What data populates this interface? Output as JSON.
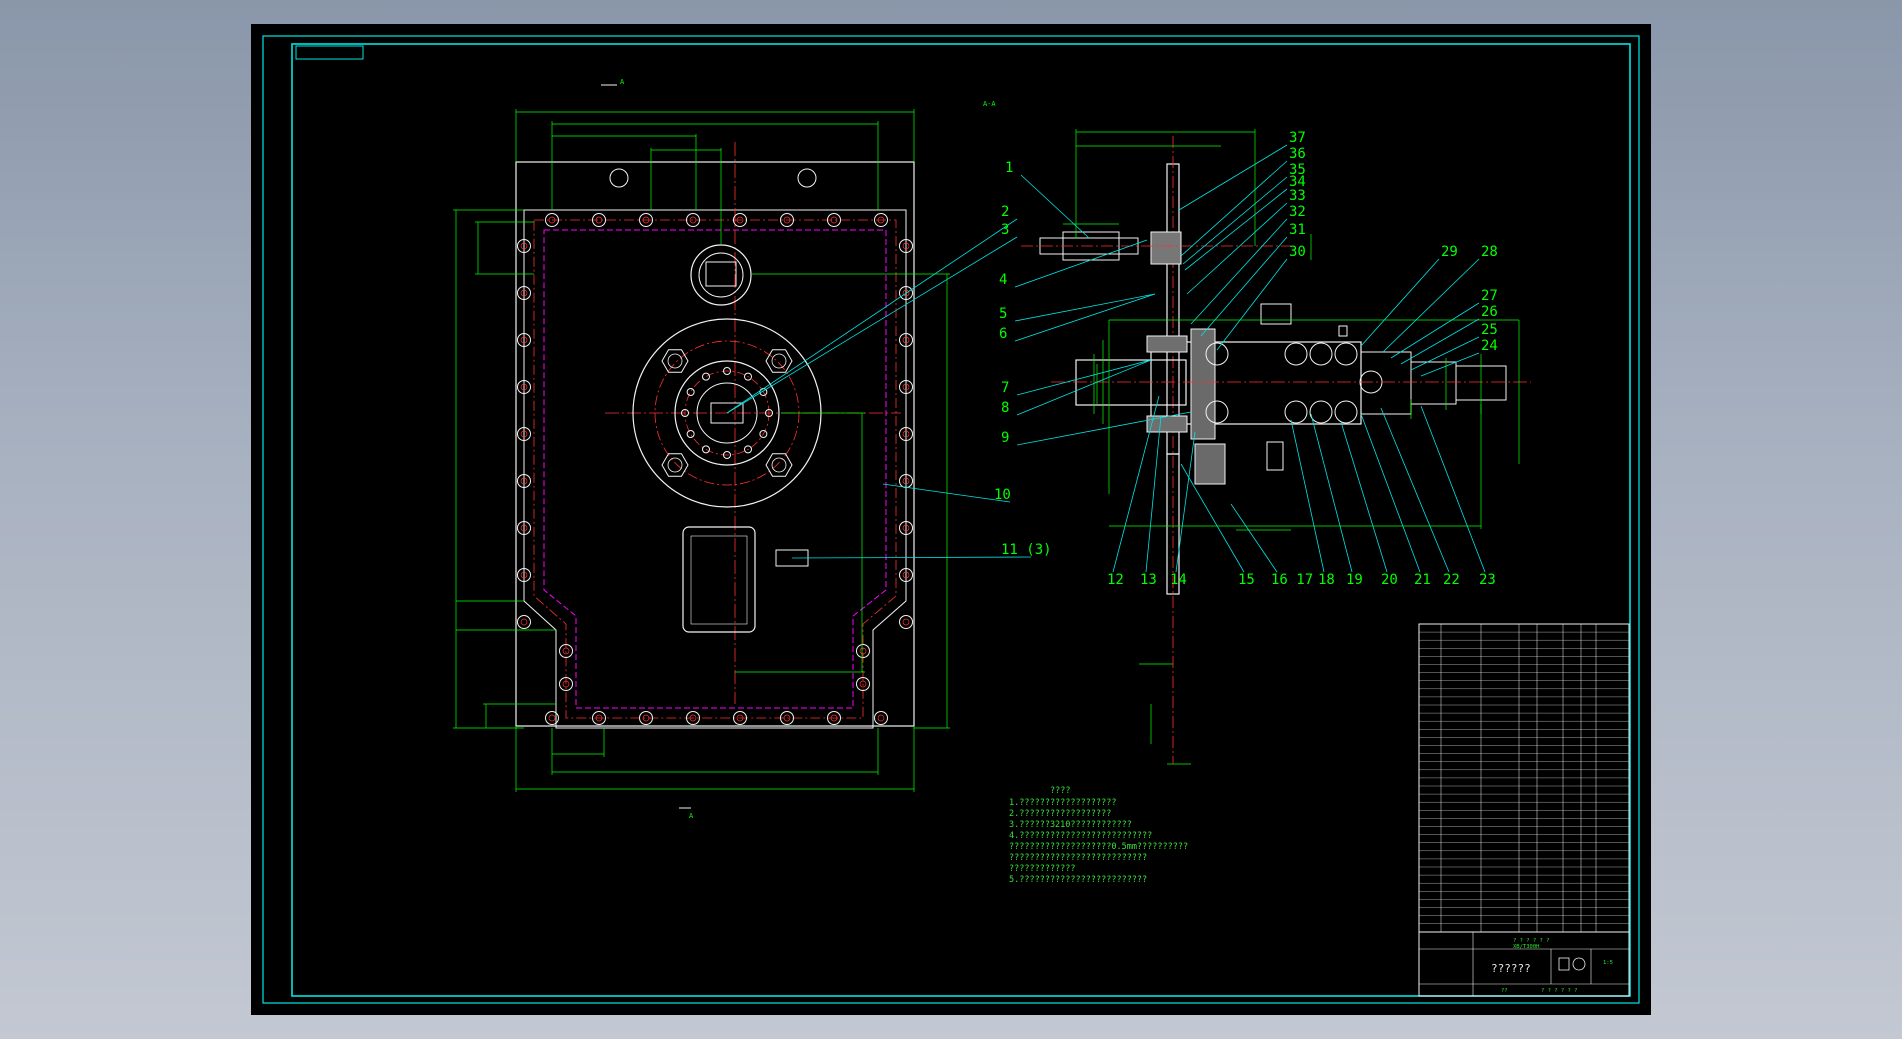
{
  "colors": {
    "background": "#000000",
    "border": "#00e5e5",
    "outline": "#f2f2f2",
    "centerline": "#ff3030",
    "hidden": "#ff00ff",
    "dimension": "#00ff00"
  },
  "view_markers": {
    "top_arrow": "A",
    "bottom_arrow": "A",
    "section_title": "A-A"
  },
  "part_numbers": {
    "left_col": [
      "1",
      "2",
      "3",
      "4",
      "5",
      "6",
      "7",
      "8",
      "9",
      "10",
      "11 (3)"
    ],
    "right_col": [
      "37",
      "36",
      "35",
      "34",
      "33",
      "32",
      "31",
      "30",
      "29",
      "28",
      "27",
      "26",
      "25",
      "24"
    ],
    "bottom_row": [
      "12",
      "13",
      "14",
      "15",
      "16 17",
      "18",
      "19",
      "20",
      "21",
      "22",
      "23"
    ]
  },
  "notes": {
    "title": "????",
    "lines": [
      "1.???????????????????",
      "2.??????????????????",
      "3.??????3210????????????",
      "4.??????????????????????????",
      "  ????????????????????0.5mm??????????",
      "  ???????????????????????????",
      "  ?????????????",
      "5.?????????????????????????"
    ]
  },
  "title_block": {
    "drawing_no": "XB/T300H",
    "name": "??????",
    "header": "? ? ? ? ? ?",
    "footer": "? ? ? ? ? ?",
    "scale": "1:5",
    "unit": "??"
  }
}
